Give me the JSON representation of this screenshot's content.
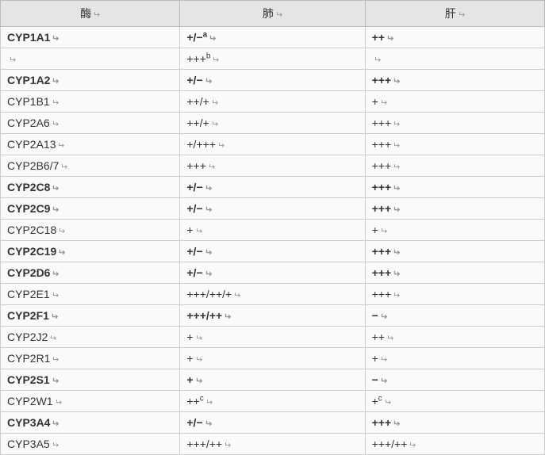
{
  "headers": {
    "enzyme": "酶",
    "lung": "肺",
    "liver": "肝"
  },
  "return_symbol": "↵",
  "chart_data": {
    "type": "table",
    "columns": [
      "酶",
      "肺",
      "肝"
    ],
    "rows": [
      {
        "enzyme": "CYP1A1",
        "lung": "+/−",
        "lung_sup": "a",
        "liver": "++",
        "bold": true
      },
      {
        "enzyme": "",
        "lung": "+++",
        "lung_sup": "b",
        "liver": "",
        "bold": false
      },
      {
        "enzyme": "CYP1A2",
        "lung": "+/−",
        "liver": "+++",
        "bold": true
      },
      {
        "enzyme": "CYP1B1",
        "lung": "++/+",
        "liver": "+",
        "bold": false
      },
      {
        "enzyme": "CYP2A6",
        "lung": "++/+",
        "liver": "+++",
        "bold": false
      },
      {
        "enzyme": "CYP2A13",
        "lung": "+/+++",
        "liver": "+++",
        "bold": false
      },
      {
        "enzyme": "CYP2B6/7",
        "lung": "+++",
        "liver": "+++",
        "bold": false
      },
      {
        "enzyme": "CYP2C8",
        "lung": "+/−",
        "liver": "+++",
        "bold": true
      },
      {
        "enzyme": "CYP2C9",
        "lung": "+/−",
        "liver": "+++",
        "bold": true
      },
      {
        "enzyme": "CYP2C18",
        "lung": "+",
        "liver": "+",
        "bold": false
      },
      {
        "enzyme": "CYP2C19",
        "lung": "+/−",
        "liver": "+++",
        "bold": true
      },
      {
        "enzyme": "CYP2D6",
        "lung": "+/−",
        "liver": "+++",
        "bold": true
      },
      {
        "enzyme": "CYP2E1",
        "lung": "+++/++/+",
        "liver": "+++",
        "bold": false
      },
      {
        "enzyme": "CYP2F1",
        "lung": "+++/++",
        "liver": "−",
        "bold": true
      },
      {
        "enzyme": "CYP2J2",
        "lung": "+",
        "liver": "++",
        "bold": false
      },
      {
        "enzyme": "CYP2R1",
        "lung": "+",
        "liver": "+",
        "bold": false
      },
      {
        "enzyme": "CYP2S1",
        "lung": "+",
        "liver": "−",
        "bold": true
      },
      {
        "enzyme": "CYP2W1",
        "lung": "++",
        "lung_sup": "c",
        "liver": "+",
        "liver_sup": "c",
        "bold": false
      },
      {
        "enzyme": "CYP3A4",
        "lung": "+/−",
        "liver": "+++",
        "bold": true
      },
      {
        "enzyme": "CYP3A5",
        "lung": "+++/++",
        "liver": "+++/++",
        "bold": false
      }
    ]
  }
}
